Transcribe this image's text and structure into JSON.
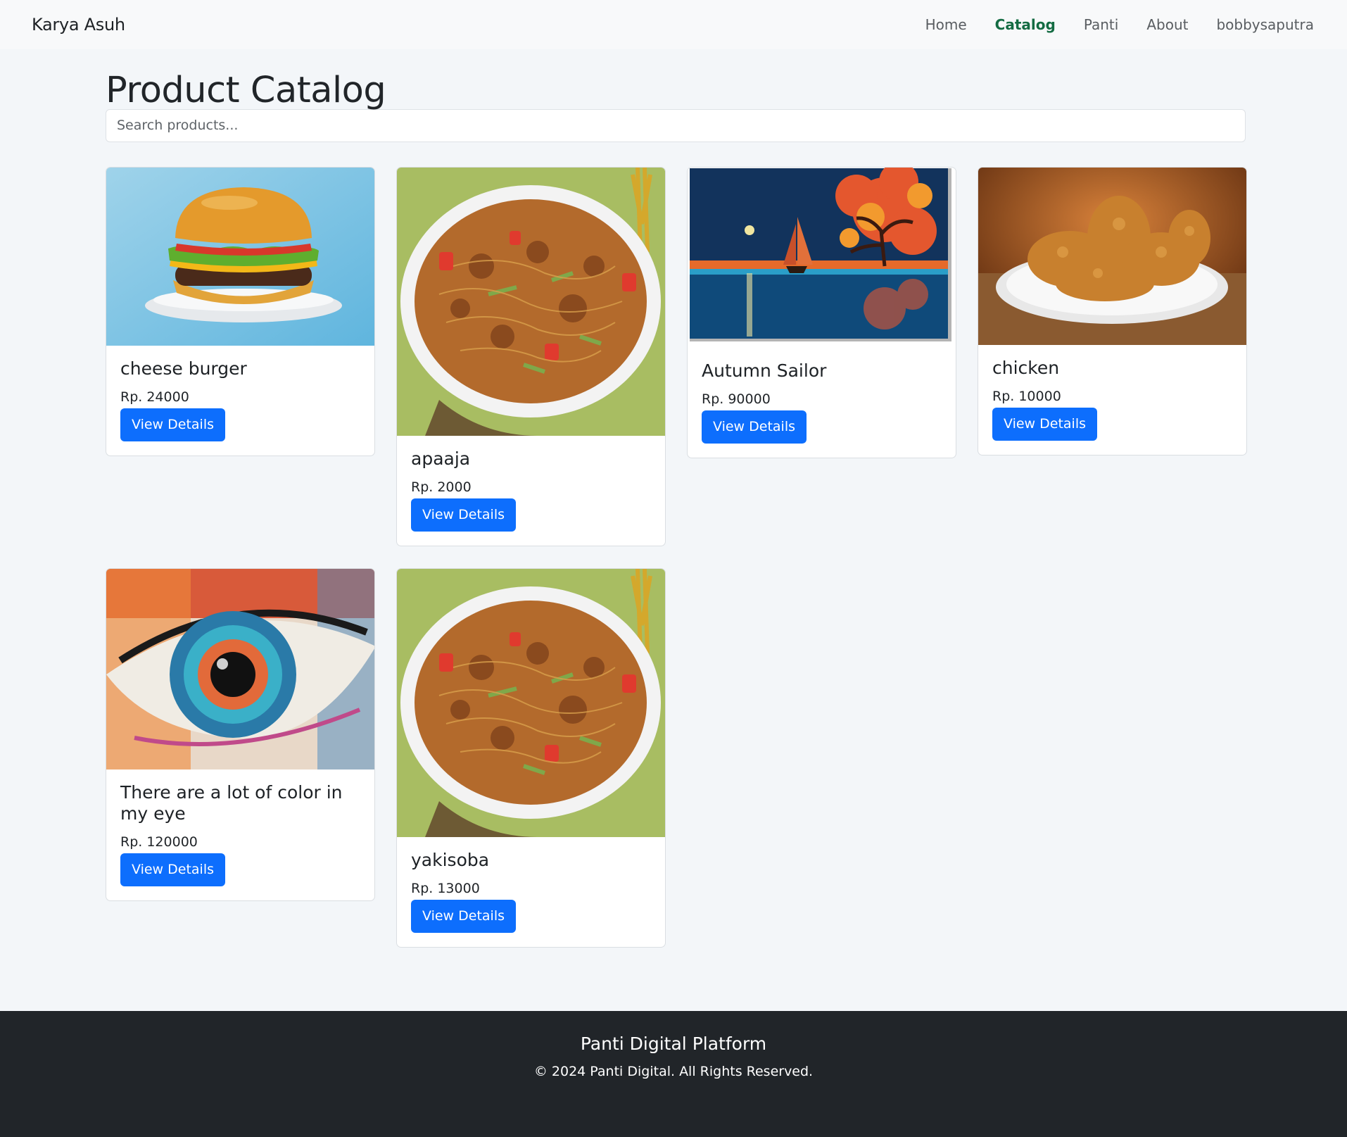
{
  "navbar": {
    "brand": "Karya Asuh",
    "links": [
      {
        "label": "Home"
      },
      {
        "label": "Catalog",
        "active": true
      },
      {
        "label": "Panti"
      },
      {
        "label": "About"
      },
      {
        "label": "bobbysaputra"
      }
    ]
  },
  "page": {
    "title": "Product Catalog",
    "search_placeholder": "Search products..."
  },
  "products": [
    {
      "name": "cheese burger",
      "price": "Rp. 24000",
      "button": "View Details"
    },
    {
      "name": "apaaja",
      "price": "Rp. 2000",
      "button": "View Details"
    },
    {
      "name": "Autumn Sailor",
      "price": "Rp. 90000",
      "button": "View Details"
    },
    {
      "name": "chicken",
      "price": "Rp. 10000",
      "button": "View Details"
    },
    {
      "name": "There are a lot of color in my eye",
      "price": "Rp. 120000",
      "button": "View Details"
    },
    {
      "name": "yakisoba",
      "price": "Rp. 13000",
      "button": "View Details"
    }
  ],
  "footer": {
    "title": "Panti Digital Platform",
    "copyright": "© 2024 Panti Digital. All Rights Reserved."
  },
  "colors": {
    "primary_button": "#0d6efd",
    "active_nav": "#146c43",
    "footer_bg": "#212529",
    "page_bg": "#f3f6f9"
  }
}
